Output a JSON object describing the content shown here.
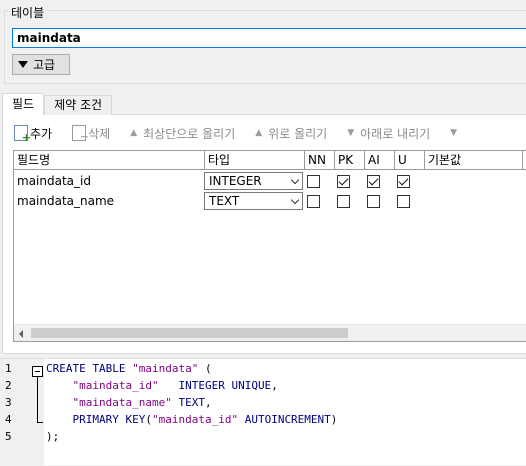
{
  "table_group": {
    "legend": "테이블",
    "name_value": "maindata",
    "advanced_label": "고급"
  },
  "tabs": [
    {
      "label": "필드",
      "active": true
    },
    {
      "label": "제약 조건",
      "active": false
    }
  ],
  "toolbar": {
    "add_label": "추가",
    "delete_label": "삭제",
    "move_top_label": "최상단으로 올리기",
    "move_up_label": "위로 올리기",
    "move_down_label": "아래로 내리기"
  },
  "grid": {
    "headers": {
      "name": "필드명",
      "type": "타입",
      "nn": "NN",
      "pk": "PK",
      "ai": "AI",
      "u": "U",
      "default": "기본값"
    },
    "rows": [
      {
        "name": "maindata_id",
        "type": "INTEGER",
        "nn": false,
        "pk": true,
        "ai": true,
        "u": true
      },
      {
        "name": "maindata_name",
        "type": "TEXT",
        "nn": false,
        "pk": false,
        "ai": false,
        "u": false
      }
    ]
  },
  "sql": {
    "line_numbers": [
      "1",
      "2",
      "3",
      "4",
      "5"
    ],
    "lines": [
      [
        {
          "t": "kw",
          "v": "CREATE TABLE "
        },
        {
          "t": "str",
          "v": "\"maindata\""
        },
        {
          "t": "punct",
          "v": " ("
        }
      ],
      [
        {
          "t": "punct",
          "v": "    "
        },
        {
          "t": "str",
          "v": "\"maindata_id\""
        },
        {
          "t": "punct",
          "v": "   "
        },
        {
          "t": "kw",
          "v": "INTEGER UNIQUE"
        },
        {
          "t": "punct",
          "v": ","
        }
      ],
      [
        {
          "t": "punct",
          "v": "    "
        },
        {
          "t": "str",
          "v": "\"maindata_name\""
        },
        {
          "t": "punct",
          "v": " "
        },
        {
          "t": "kw",
          "v": "TEXT"
        },
        {
          "t": "punct",
          "v": ","
        }
      ],
      [
        {
          "t": "punct",
          "v": "    "
        },
        {
          "t": "kw",
          "v": "PRIMARY KEY"
        },
        {
          "t": "punct",
          "v": "("
        },
        {
          "t": "str",
          "v": "\"maindata_id\""
        },
        {
          "t": "punct",
          "v": " "
        },
        {
          "t": "kw",
          "v": "AUTOINCREMENT"
        },
        {
          "t": "punct",
          "v": ")"
        }
      ],
      [
        {
          "t": "punct",
          "v": ");"
        }
      ]
    ]
  }
}
